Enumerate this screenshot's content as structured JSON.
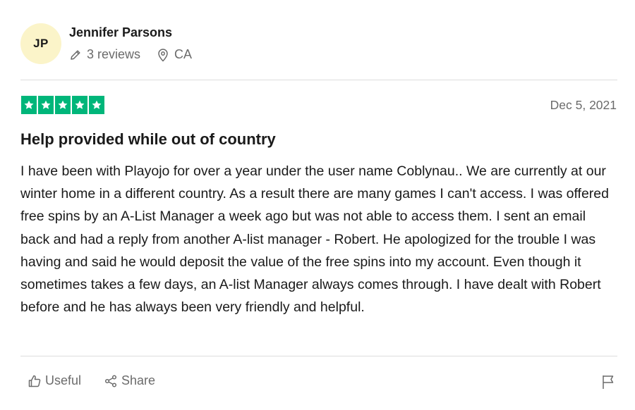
{
  "reviewer": {
    "initials": "JP",
    "name": "Jennifer Parsons",
    "reviews": "3 reviews",
    "location": "CA"
  },
  "review": {
    "rating": 5,
    "max_rating": 5,
    "date": "Dec 5, 2021",
    "title": "Help provided while out of country",
    "body": "I have been with Playojo for over a year under the user name Coblynau.. We are currently at our winter home in a different country. As a result there are many games I can't access. I was offered free spins by an A-List Manager a week ago but was not able to access them. I sent an email back and had a reply from another A-list manager - Robert. He apologized for the trouble I was having and said he would deposit the value of the free spins into my account. Even though it sometimes takes a few days, an A-list Manager always comes through. I have dealt with Robert before and he has always been very friendly and helpful."
  },
  "actions": {
    "useful": "Useful",
    "share": "Share"
  },
  "icons": {
    "pencil": "pencil-icon",
    "location": "location-pin-icon",
    "star": "star-icon",
    "thumbs_up": "thumbs-up-icon",
    "share": "share-icon",
    "flag": "flag-icon"
  },
  "colors": {
    "star_green": "#00b67a",
    "avatar_bg": "#fbf4c9",
    "muted_text": "#6b6b6b"
  }
}
